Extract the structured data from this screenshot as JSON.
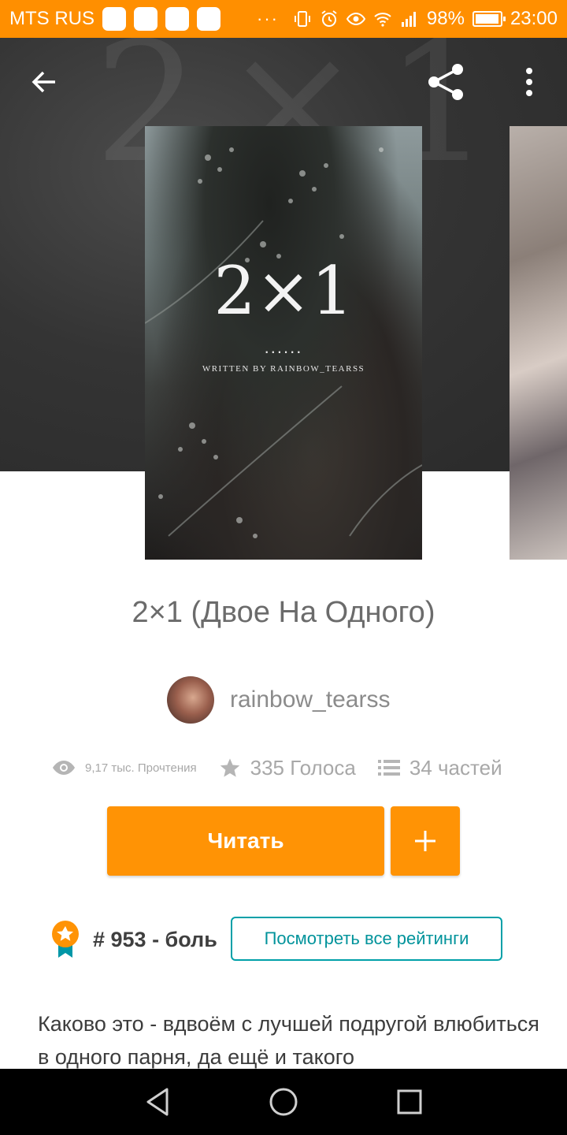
{
  "status_bar": {
    "carrier": "MTS RUS",
    "dots": "···",
    "battery_level": "98%",
    "time": "23:00",
    "icons": [
      "vibrate-icon",
      "alarm-icon",
      "eye-icon",
      "wifi-icon",
      "signal-icon",
      "battery-icon"
    ]
  },
  "header": {
    "icons": [
      "back-arrow-icon",
      "share-icon",
      "more-vertical-icon"
    ]
  },
  "cover": {
    "title": "2×1",
    "dots": "......",
    "byline": "WRITTEN BY RAINBOW_TEARSS"
  },
  "story": {
    "title": "2×1 (Двое На Одного)",
    "author": "rainbow_tearss",
    "reads": "9,17 тыс. Прочтения",
    "votes": "335 Голоса",
    "parts": "34 частей"
  },
  "actions": {
    "read_label": "Читать",
    "add_label": "+"
  },
  "ranking": {
    "text": "# 953 - боль",
    "link_label": "Посмотреть все рейтинги"
  },
  "description": "Каково это - вдвоём с лучшей подругой влюбиться в одного парня, да ещё и такого",
  "colors": {
    "status_bar": "#ff8f00",
    "accent": "#ff9305",
    "link": "#00a0a8"
  }
}
